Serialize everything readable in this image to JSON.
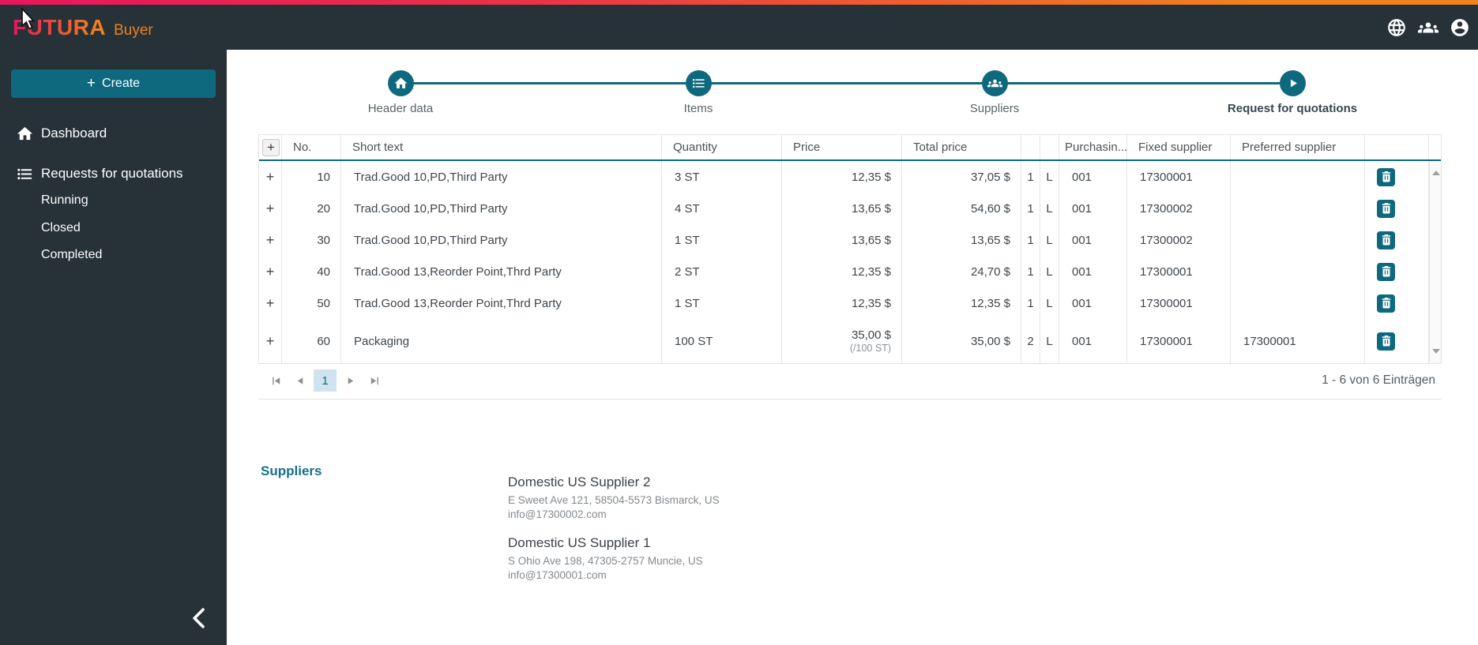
{
  "brand": {
    "name": "FUTURA",
    "product": "Buyer"
  },
  "sidebar": {
    "create_label": "Create",
    "items": [
      {
        "label": "Dashboard",
        "icon": "home"
      },
      {
        "label": "Requests for quotations",
        "icon": "list"
      }
    ],
    "subitems": [
      "Running",
      "Closed",
      "Completed"
    ]
  },
  "stepper": {
    "steps": [
      {
        "label": "Header data",
        "icon": "home"
      },
      {
        "label": "Items",
        "icon": "list"
      },
      {
        "label": "Suppliers",
        "icon": "people"
      },
      {
        "label": "Request for quotations",
        "icon": "play"
      }
    ]
  },
  "table": {
    "columns": [
      "",
      "No.",
      "Short text",
      "Quantity",
      "Price",
      "Total price",
      "",
      "",
      "Purchasin...",
      "Fixed supplier",
      "Preferred supplier",
      ""
    ],
    "rows": [
      {
        "no": "10",
        "short_text": "Trad.Good 10,PD,Third Party",
        "quantity": "3 ST",
        "price": "12,35 $",
        "price_note": "",
        "total": "37,05 $",
        "c1": "1",
        "c2": "L",
        "purchasing": "001",
        "fixed_supplier": "17300001",
        "preferred_supplier": ""
      },
      {
        "no": "20",
        "short_text": "Trad.Good 10,PD,Third Party",
        "quantity": "4 ST",
        "price": "13,65 $",
        "price_note": "",
        "total": "54,60 $",
        "c1": "1",
        "c2": "L",
        "purchasing": "001",
        "fixed_supplier": "17300002",
        "preferred_supplier": ""
      },
      {
        "no": "30",
        "short_text": "Trad.Good 10,PD,Third Party",
        "quantity": "1 ST",
        "price": "13,65 $",
        "price_note": "",
        "total": "13,65 $",
        "c1": "1",
        "c2": "L",
        "purchasing": "001",
        "fixed_supplier": "17300002",
        "preferred_supplier": ""
      },
      {
        "no": "40",
        "short_text": "Trad.Good 13,Reorder Point,Thrd Party",
        "quantity": "2 ST",
        "price": "12,35 $",
        "price_note": "",
        "total": "24,70 $",
        "c1": "1",
        "c2": "L",
        "purchasing": "001",
        "fixed_supplier": "17300001",
        "preferred_supplier": ""
      },
      {
        "no": "50",
        "short_text": "Trad.Good 13,Reorder Point,Thrd Party",
        "quantity": "1 ST",
        "price": "12,35 $",
        "price_note": "",
        "total": "12,35 $",
        "c1": "1",
        "c2": "L",
        "purchasing": "001",
        "fixed_supplier": "17300001",
        "preferred_supplier": ""
      },
      {
        "no": "60",
        "short_text": "Packaging",
        "quantity": "100 ST",
        "price": "35,00 $",
        "price_note": "(/100 ST)",
        "total": "35,00 $",
        "c1": "2",
        "c2": "L",
        "purchasing": "001",
        "fixed_supplier": "17300001",
        "preferred_supplier": "17300001"
      }
    ],
    "pagination": {
      "page": "1",
      "summary": "1 - 6 von 6 Einträgen"
    }
  },
  "suppliers": {
    "heading": "Suppliers",
    "entries": [
      {
        "name": "Domestic US Supplier 2",
        "address": "E Sweet Ave 121, 58504-5573 Bismarck, US",
        "email": "info@17300002.com"
      },
      {
        "name": "Domestic US Supplier 1",
        "address": "S Ohio Ave 198, 47305-2757 Muncie, US",
        "email": "info@17300001.com"
      }
    ]
  }
}
